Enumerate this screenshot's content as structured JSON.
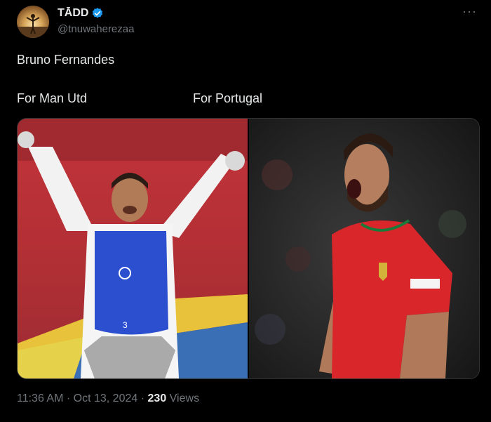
{
  "author": {
    "display_name": "TĀDD",
    "handle": "@tnuwaherezaa",
    "verified": true
  },
  "tweet": {
    "text": "Bruno Fernandes",
    "caption_left": "For Man Utd",
    "caption_right": "For Portugal"
  },
  "media": {
    "left_image": "taekwondo athlete celebrating",
    "right_image": "footballer in red Portugal kit celebrating",
    "left_badge_number": "3"
  },
  "meta": {
    "time": "11:36 AM",
    "date": "Oct 13, 2024",
    "separator": "·",
    "views_count": "230",
    "views_label": "Views"
  },
  "colors": {
    "background": "#000000",
    "text": "#e7e9ea",
    "muted": "#71767b",
    "verified": "#1d9bf0"
  }
}
